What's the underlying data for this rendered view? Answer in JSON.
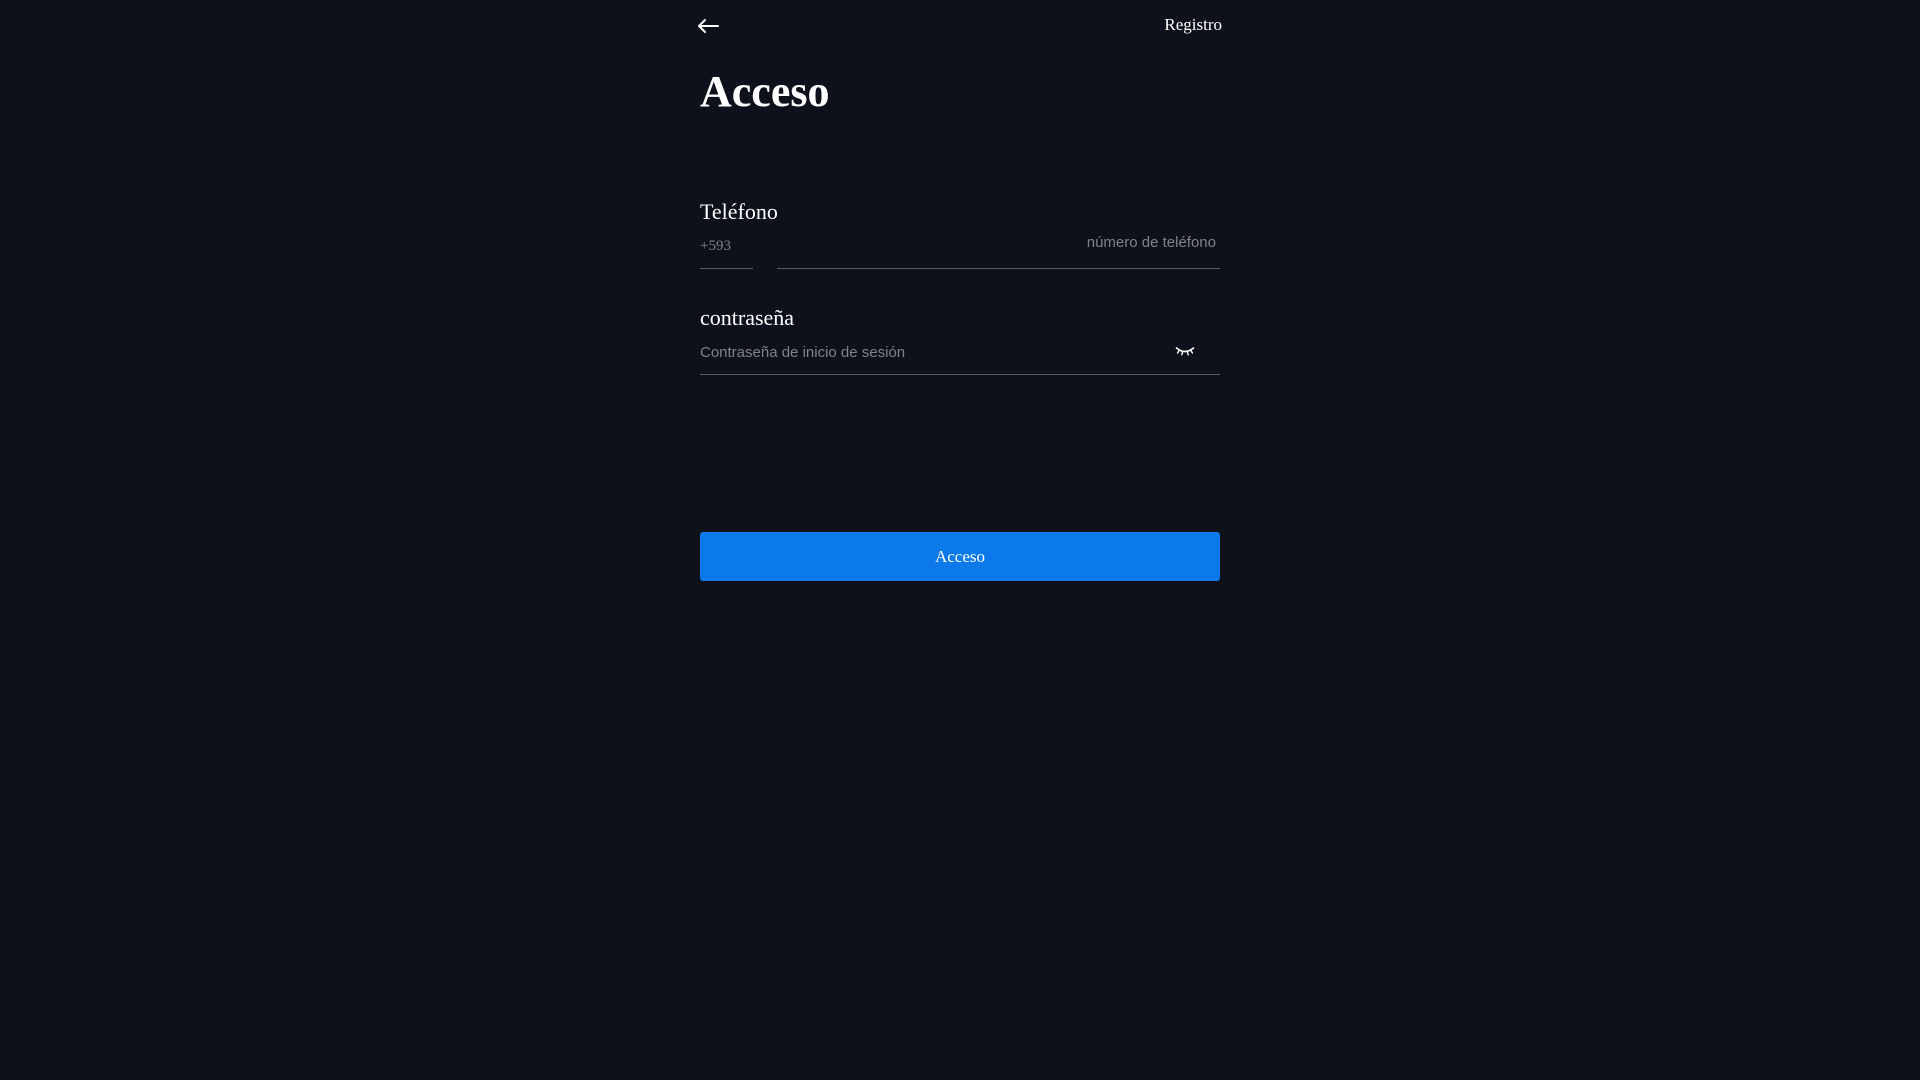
{
  "header": {
    "back_icon": "arrow-left-icon",
    "register_label": "Registro"
  },
  "title": "Acceso",
  "phone": {
    "label": "Teléfono",
    "country_code": "+593",
    "placeholder": "número de teléfono",
    "value": ""
  },
  "password": {
    "label": "contraseña",
    "placeholder": "Contraseña de inicio de sesión",
    "value": "",
    "toggle_icon": "eye-closed-icon"
  },
  "submit": {
    "label": "Acceso"
  },
  "colors": {
    "background": "#0c111b",
    "accent": "#0b79ea",
    "placeholder": "#7d828c",
    "divider": "#545a66"
  }
}
